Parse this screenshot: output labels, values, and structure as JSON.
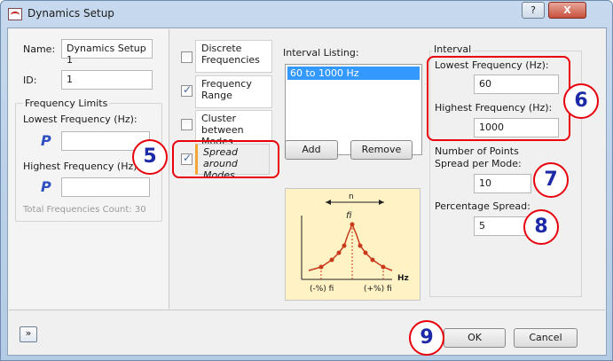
{
  "window": {
    "title": "Dynamics Setup",
    "help_label": "?",
    "close_label": "X"
  },
  "left": {
    "name_label": "Name:",
    "name_value": "Dynamics Setup 1",
    "id_label": "ID:",
    "id_value": "1",
    "freq_limits_title": "Frequency Limits",
    "lowest_label": "Lowest Frequency (Hz):",
    "highest_label": "Highest Frequency (Hz):",
    "p_glyph": "P",
    "total_count": "Total Frequencies Count: 30"
  },
  "tabs": [
    {
      "label": "Discrete Frequencies",
      "checked": false
    },
    {
      "label": "Frequency Range",
      "checked": true
    },
    {
      "label": "Cluster between Modes",
      "checked": false
    },
    {
      "label": "Spread around Modes",
      "checked": true
    }
  ],
  "interval_listing": {
    "label": "Interval Listing:",
    "items": [
      "60 to 1000 Hz"
    ]
  },
  "buttons": {
    "add": "Add",
    "remove": "Remove",
    "ok": "OK",
    "cancel": "Cancel",
    "expand_glyph": "»"
  },
  "diagram": {
    "n_label": "n",
    "peak_label": "fi",
    "left_label": "(-%) fi",
    "right_label": "(+%) fi",
    "axis_label": "Hz"
  },
  "interval": {
    "title": "Interval",
    "lowest_label": "Lowest Frequency (Hz):",
    "lowest_value": "60",
    "highest_label": "Highest Frequency (Hz):",
    "highest_value": "1000",
    "points_label_1": "Number of Points",
    "points_label_2": "Spread per Mode:",
    "points_value": "10",
    "percent_label": "Percentage Spread:",
    "percent_value": "5"
  },
  "callouts": [
    "5",
    "6",
    "7",
    "8",
    "9"
  ],
  "colors": {
    "callout_border": "#e8000b",
    "callout_text": "#1c2aa8",
    "selection": "#3399ff",
    "diagram_bg": "#fff3c6"
  },
  "icons": [
    "dynamics-app-icon",
    "help-icon",
    "close-icon",
    "expand-icon",
    "p-tool-icon"
  ]
}
